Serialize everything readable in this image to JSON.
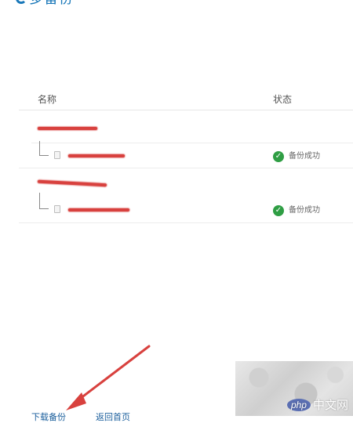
{
  "logo": {
    "text": "多备份"
  },
  "table": {
    "headers": {
      "name": "名称",
      "status": "状态"
    },
    "groups": [
      {
        "file": {
          "status": "备份成功"
        }
      },
      {
        "file": {
          "status": "备份成功"
        }
      }
    ]
  },
  "footer": {
    "link_download": "下载备份",
    "link_back": "返回首页"
  },
  "watermark": {
    "badge": "php",
    "text": "中文网"
  },
  "colors": {
    "brand": "#1a78b9",
    "success": "#2f9e44",
    "annotation": "#d8413e"
  },
  "icons": {
    "status": "check-circle-icon",
    "file": "file-icon"
  }
}
